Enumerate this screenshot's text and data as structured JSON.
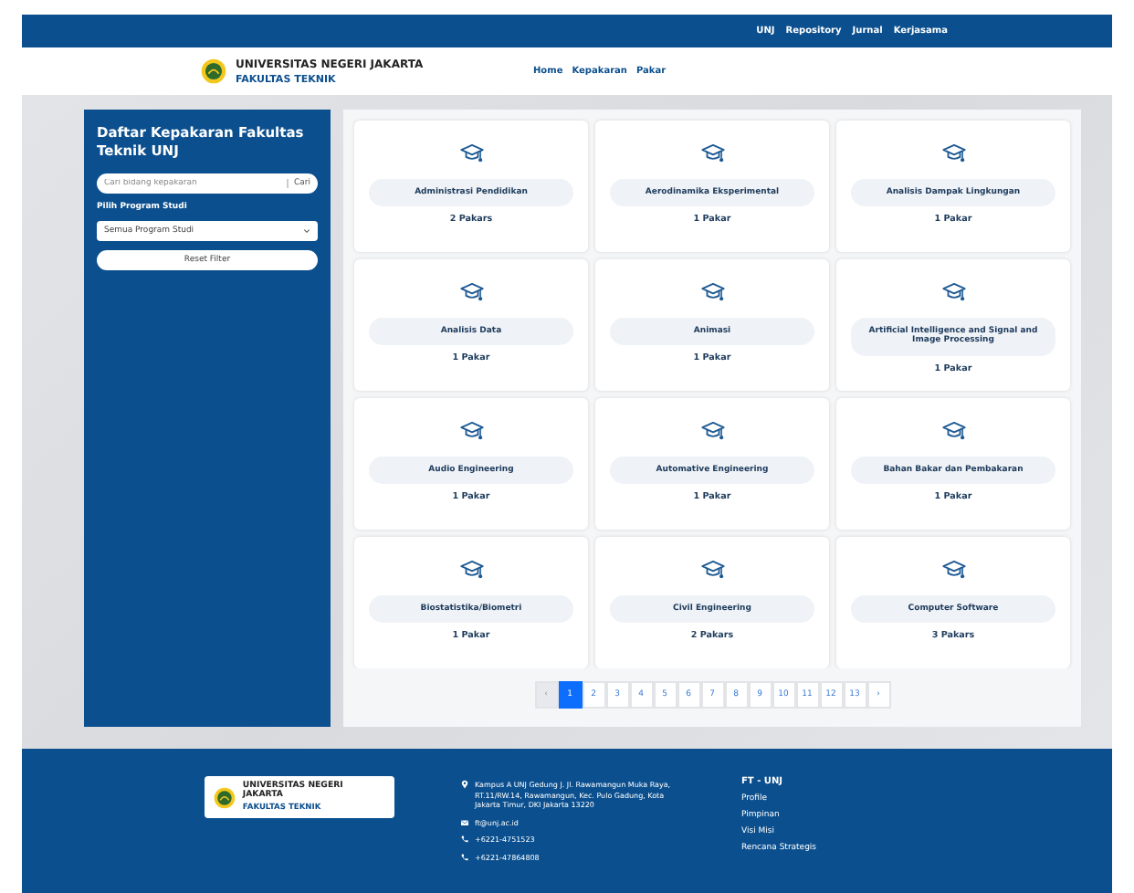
{
  "top_links": [
    "UNJ",
    "Repository",
    "Jurnal",
    "Kerjasama"
  ],
  "header": {
    "university": "UNIVERSITAS NEGERI JAKARTA",
    "faculty": "FAKULTAS TEKNIK",
    "nav": [
      "Home",
      "Kepakaran",
      "Pakar"
    ]
  },
  "sidebar": {
    "title": "Daftar Kepakaran Fakultas Teknik UNJ",
    "search": {
      "placeholder": "Cari bidang kepakaran",
      "button": "Cari"
    },
    "program_label": "Pilih Program Studi",
    "program_value": "Semua Program Studi",
    "reset": "Reset Filter"
  },
  "cards": [
    {
      "name": "Administrasi Pendidikan",
      "count": "2 Pakars"
    },
    {
      "name": "Aerodinamika Eksperimental",
      "count": "1 Pakar"
    },
    {
      "name": "Analisis Dampak Lingkungan",
      "count": "1 Pakar"
    },
    {
      "name": "Analisis Data",
      "count": "1 Pakar"
    },
    {
      "name": "Animasi",
      "count": "1 Pakar"
    },
    {
      "name": "Artificial Intelligence and Signal and Image Processing",
      "count": "1 Pakar"
    },
    {
      "name": "Audio Engineering",
      "count": "1 Pakar"
    },
    {
      "name": "Automative Engineering",
      "count": "1 Pakar"
    },
    {
      "name": "Bahan Bakar dan Pembakaran",
      "count": "1 Pakar"
    },
    {
      "name": "Biostatistika/Biometri",
      "count": "1 Pakar"
    },
    {
      "name": "Civil Engineering",
      "count": "2 Pakars"
    },
    {
      "name": "Computer Software",
      "count": "3 Pakars"
    }
  ],
  "pagination": {
    "prev": "‹",
    "next": "›",
    "pages": [
      {
        "label": "1",
        "selected": true
      },
      {
        "label": "2",
        "selected": false
      },
      {
        "label": "3",
        "selected": false
      },
      {
        "label": "4",
        "selected": false
      },
      {
        "label": "5",
        "selected": false
      },
      {
        "label": "6",
        "selected": false
      },
      {
        "label": "7",
        "selected": false
      },
      {
        "label": "8",
        "selected": false
      },
      {
        "label": "9",
        "selected": false
      },
      {
        "label": "10",
        "selected": false
      },
      {
        "label": "11",
        "selected": false
      },
      {
        "label": "12",
        "selected": false
      },
      {
        "label": "13",
        "selected": false
      }
    ]
  },
  "footer": {
    "university": "UNIVERSITAS NEGERI JAKARTA",
    "faculty": "FAKULTAS TEKNIK",
    "contacts": [
      {
        "kind": "address",
        "text": "Kampus A UNJ Gedung J. Jl. Rawamangun Muka Raya, RT.11/RW.14, Rawamangun, Kec. Pulo Gadung, Kota Jakarta Timur, DKI Jakarta 13220"
      },
      {
        "kind": "email",
        "text": "ft@unj.ac.id"
      },
      {
        "kind": "phone",
        "text": "+6221-4751523"
      },
      {
        "kind": "phone",
        "text": "+6221-47864808"
      }
    ],
    "links_title": "FT - UNJ",
    "links": [
      "Profile",
      "Pimpinan",
      "Visi Misi",
      "Rencana Strategis"
    ]
  }
}
